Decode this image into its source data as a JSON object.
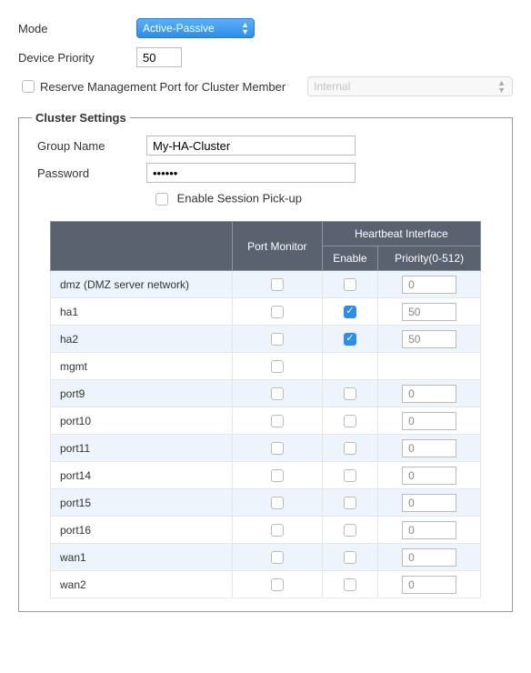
{
  "mode": {
    "label": "Mode",
    "value": "Active-Passive"
  },
  "device_priority": {
    "label": "Device Priority",
    "value": "50"
  },
  "reserve": {
    "label": "Reserve Management Port for Cluster Member",
    "checked": false,
    "port_value": "Internal"
  },
  "cluster": {
    "legend": "Cluster Settings",
    "group_name": {
      "label": "Group Name",
      "value": "My-HA-Cluster"
    },
    "password": {
      "label": "Password",
      "value": "••••••"
    },
    "session_pickup": {
      "label": "Enable Session Pick-up",
      "checked": false
    }
  },
  "table": {
    "headers": {
      "port_monitor": "Port Monitor",
      "heartbeat": "Heartbeat Interface",
      "enable": "Enable",
      "priority": "Priority(0-512)"
    },
    "rows": [
      {
        "name": "dmz (DMZ server network)",
        "port_monitor": false,
        "hb_enable": false,
        "hb_priority": "0"
      },
      {
        "name": "ha1",
        "port_monitor": false,
        "hb_enable": true,
        "hb_priority": "50"
      },
      {
        "name": "ha2",
        "port_monitor": false,
        "hb_enable": true,
        "hb_priority": "50"
      },
      {
        "name": "mgmt",
        "port_monitor": false,
        "hb_enable": null,
        "hb_priority": null
      },
      {
        "name": "port9",
        "port_monitor": false,
        "hb_enable": false,
        "hb_priority": "0"
      },
      {
        "name": "port10",
        "port_monitor": false,
        "hb_enable": false,
        "hb_priority": "0"
      },
      {
        "name": "port11",
        "port_monitor": false,
        "hb_enable": false,
        "hb_priority": "0"
      },
      {
        "name": "port14",
        "port_monitor": false,
        "hb_enable": false,
        "hb_priority": "0"
      },
      {
        "name": "port15",
        "port_monitor": false,
        "hb_enable": false,
        "hb_priority": "0"
      },
      {
        "name": "port16",
        "port_monitor": false,
        "hb_enable": false,
        "hb_priority": "0"
      },
      {
        "name": "wan1",
        "port_monitor": false,
        "hb_enable": false,
        "hb_priority": "0"
      },
      {
        "name": "wan2",
        "port_monitor": false,
        "hb_enable": false,
        "hb_priority": "0"
      }
    ]
  }
}
